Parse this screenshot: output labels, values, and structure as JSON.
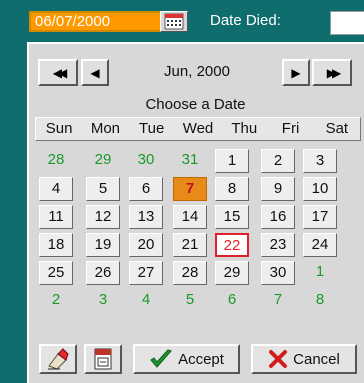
{
  "date_field": {
    "value": "06/07/2000"
  },
  "died_label": "Date Died:",
  "nav": {
    "first": "◀◀",
    "prev": "◀",
    "next": "▶",
    "last": "▶▶"
  },
  "month_label": "Jun, 2000",
  "choose_label": "Choose a Date",
  "weekdays": [
    "Sun",
    "Mon",
    "Tue",
    "Wed",
    "Thu",
    "Fri",
    "Sat"
  ],
  "weeks": [
    [
      {
        "d": "28",
        "t": "other"
      },
      {
        "d": "29",
        "t": "other"
      },
      {
        "d": "30",
        "t": "other"
      },
      {
        "d": "31",
        "t": "other"
      },
      {
        "d": "1",
        "t": "cur"
      },
      {
        "d": "2",
        "t": "cur"
      },
      {
        "d": "3",
        "t": "cur"
      }
    ],
    [
      {
        "d": "4",
        "t": "cur"
      },
      {
        "d": "5",
        "t": "cur"
      },
      {
        "d": "6",
        "t": "cur"
      },
      {
        "d": "7",
        "t": "sel"
      },
      {
        "d": "8",
        "t": "cur"
      },
      {
        "d": "9",
        "t": "cur"
      },
      {
        "d": "10",
        "t": "cur"
      }
    ],
    [
      {
        "d": "11",
        "t": "cur"
      },
      {
        "d": "12",
        "t": "cur"
      },
      {
        "d": "13",
        "t": "cur"
      },
      {
        "d": "14",
        "t": "cur"
      },
      {
        "d": "15",
        "t": "cur"
      },
      {
        "d": "16",
        "t": "cur"
      },
      {
        "d": "17",
        "t": "cur"
      }
    ],
    [
      {
        "d": "18",
        "t": "cur"
      },
      {
        "d": "19",
        "t": "cur"
      },
      {
        "d": "20",
        "t": "cur"
      },
      {
        "d": "21",
        "t": "cur"
      },
      {
        "d": "22",
        "t": "today"
      },
      {
        "d": "23",
        "t": "cur"
      },
      {
        "d": "24",
        "t": "cur"
      }
    ],
    [
      {
        "d": "25",
        "t": "cur"
      },
      {
        "d": "26",
        "t": "cur"
      },
      {
        "d": "27",
        "t": "cur"
      },
      {
        "d": "28",
        "t": "cur"
      },
      {
        "d": "29",
        "t": "cur"
      },
      {
        "d": "30",
        "t": "cur"
      },
      {
        "d": "1",
        "t": "other"
      }
    ],
    [
      {
        "d": "2",
        "t": "other"
      },
      {
        "d": "3",
        "t": "other"
      },
      {
        "d": "4",
        "t": "other"
      },
      {
        "d": "5",
        "t": "other"
      },
      {
        "d": "6",
        "t": "other"
      },
      {
        "d": "7",
        "t": "other"
      },
      {
        "d": "8",
        "t": "other"
      }
    ]
  ],
  "buttons": {
    "accept": "Accept",
    "cancel": "Cancel"
  },
  "colors": {
    "selected": "#e88a18",
    "today_border": "#e0202a",
    "other_month": "#1a9a2a",
    "background": "#0f6d6e"
  }
}
